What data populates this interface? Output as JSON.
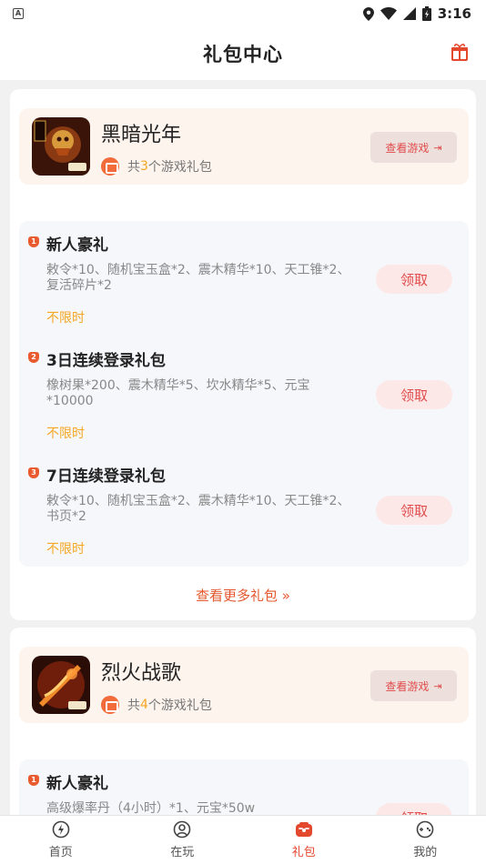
{
  "status_bar": {
    "time": "3:16"
  },
  "header": {
    "title": "礼包中心"
  },
  "games": [
    {
      "name": "黑暗光年",
      "count_prefix": "共",
      "count": "3",
      "count_suffix": "个游戏礼包",
      "view_label": "查看游戏",
      "packages": [
        {
          "badge": "1",
          "title": "新人豪礼",
          "desc": "敕令*10、随机宝玉盒*2、震木精华*10、天工锥*2、复活碎片*2",
          "limit": "不限时",
          "claim": "领取"
        },
        {
          "badge": "2",
          "title": "3日连续登录礼包",
          "desc": "橡树果*200、震木精华*5、坎水精华*5、元宝*10000",
          "limit": "不限时",
          "claim": "领取"
        },
        {
          "badge": "3",
          "title": "7日连续登录礼包",
          "desc": "敕令*10、随机宝玉盒*2、震木精华*10、天工锥*2、书页*2",
          "limit": "不限时",
          "claim": "领取"
        }
      ],
      "more_label": "查看更多礼包 »"
    },
    {
      "name": "烈火战歌",
      "count_prefix": "共",
      "count": "4",
      "count_suffix": "个游戏礼包",
      "view_label": "查看游戏",
      "packages": [
        {
          "badge": "1",
          "title": "新人豪礼",
          "desc": "高级爆率丹（4小时）*1、元宝*50w",
          "limit": "",
          "claim": "领取"
        }
      ]
    }
  ],
  "bottom_nav": [
    {
      "label": "首页",
      "icon": "home-icon",
      "active": false
    },
    {
      "label": "在玩",
      "icon": "playing-icon",
      "active": false
    },
    {
      "label": "礼包",
      "icon": "gift-bag-icon",
      "active": true
    },
    {
      "label": "我的",
      "icon": "profile-icon",
      "active": false
    }
  ],
  "colors": {
    "accent": "#e4482f",
    "orange": "#f5a623",
    "claim_bg": "#fde8e8"
  }
}
